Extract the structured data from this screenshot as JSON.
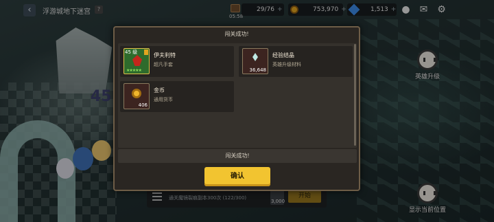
{
  "topbar": {
    "location_title": "浮游城地下迷宫",
    "help_label": "?",
    "back_label": "‹",
    "stamina": "29/76",
    "stamina_timer": "05:58",
    "gold": "753,970",
    "gems": "1,513",
    "plus": "+"
  },
  "side_buttons": {
    "hero_upgrade": "英雄升级",
    "show_position": "显示当前位置"
  },
  "background_bar": {
    "mission_text": "通关魔镜裂痕副本300次 (122/300)",
    "cost": "3,000",
    "start_label": "开始"
  },
  "scene": {
    "floor_number": "45"
  },
  "modal": {
    "title": "闯关成功!",
    "rewards": [
      {
        "name": "伊夫利特",
        "desc": "超凡手套",
        "level": "45 级",
        "stars": "★★★★★",
        "qty": "",
        "icon": "hero-portrait-icon"
      },
      {
        "name": "经验结晶",
        "desc": "英雄升级材料",
        "level": "",
        "stars": "",
        "qty": "36,648",
        "icon": "exp-crystal-icon"
      },
      {
        "name": "金币",
        "desc": "通用货币",
        "level": "",
        "stars": "",
        "qty": "406",
        "icon": "gold-coin-icon"
      }
    ],
    "message": "闯关成功!",
    "confirm_label": "确认"
  },
  "colors": {
    "accent_button": "#f2c430",
    "modal_border": "#6e5d47",
    "modal_bg": "#2a2622"
  }
}
